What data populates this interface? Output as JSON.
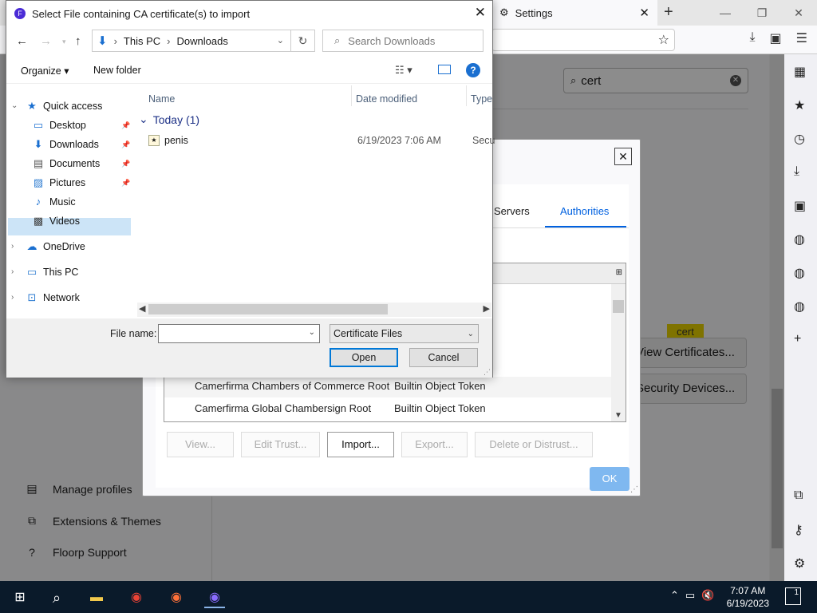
{
  "browser": {
    "tab_title": "Settings",
    "search_value": "cert",
    "highlight_tooltip": "cert",
    "view_certificates_label": "View Certificates...",
    "security_devices_label": "Security Devices...",
    "sidebar_bottom": [
      {
        "label": "Manage profiles",
        "icon": "profile-icon"
      },
      {
        "label": "Extensions & Themes",
        "icon": "puzzle-icon"
      },
      {
        "label": "Floorp Support",
        "icon": "help-circle-icon"
      }
    ]
  },
  "cert_manager": {
    "tabs": [
      {
        "label": "Servers"
      },
      {
        "label": "Authorities"
      }
    ],
    "rows": [
      {
        "name": "Camerfirma Chambers of Commerce Root",
        "device": "Builtin Object Token"
      },
      {
        "name": "Camerfirma Global Chambersign Root",
        "device": "Builtin Object Token"
      }
    ],
    "buttons": {
      "view": "View...",
      "edit_trust": "Edit Trust...",
      "import": "Import...",
      "export": "Export...",
      "delete": "Delete or Distrust..."
    },
    "ok": "OK"
  },
  "file_dialog": {
    "title": "Select File containing CA certificate(s) to import",
    "breadcrumb": [
      "This PC",
      "Downloads"
    ],
    "search_placeholder": "Search Downloads",
    "toolbar": {
      "organize": "Organize",
      "new_folder": "New folder"
    },
    "nav": {
      "quick_access": "Quick access",
      "items": [
        "Desktop",
        "Downloads",
        "Documents",
        "Pictures",
        "Music",
        "Videos"
      ],
      "onedrive": "OneDrive",
      "this_pc": "This PC",
      "network": "Network"
    },
    "columns": {
      "name": "Name",
      "date": "Date modified",
      "type": "Type"
    },
    "group": "Today (1)",
    "file": {
      "name": "penis",
      "date": "6/19/2023 7:06 AM",
      "type": "Secu"
    },
    "file_name_label": "File name:",
    "file_name_value": "",
    "file_type": "Certificate Files",
    "open": "Open",
    "cancel": "Cancel"
  },
  "taskbar": {
    "time": "7:07 AM",
    "date": "6/19/2023",
    "notifications": "1"
  }
}
